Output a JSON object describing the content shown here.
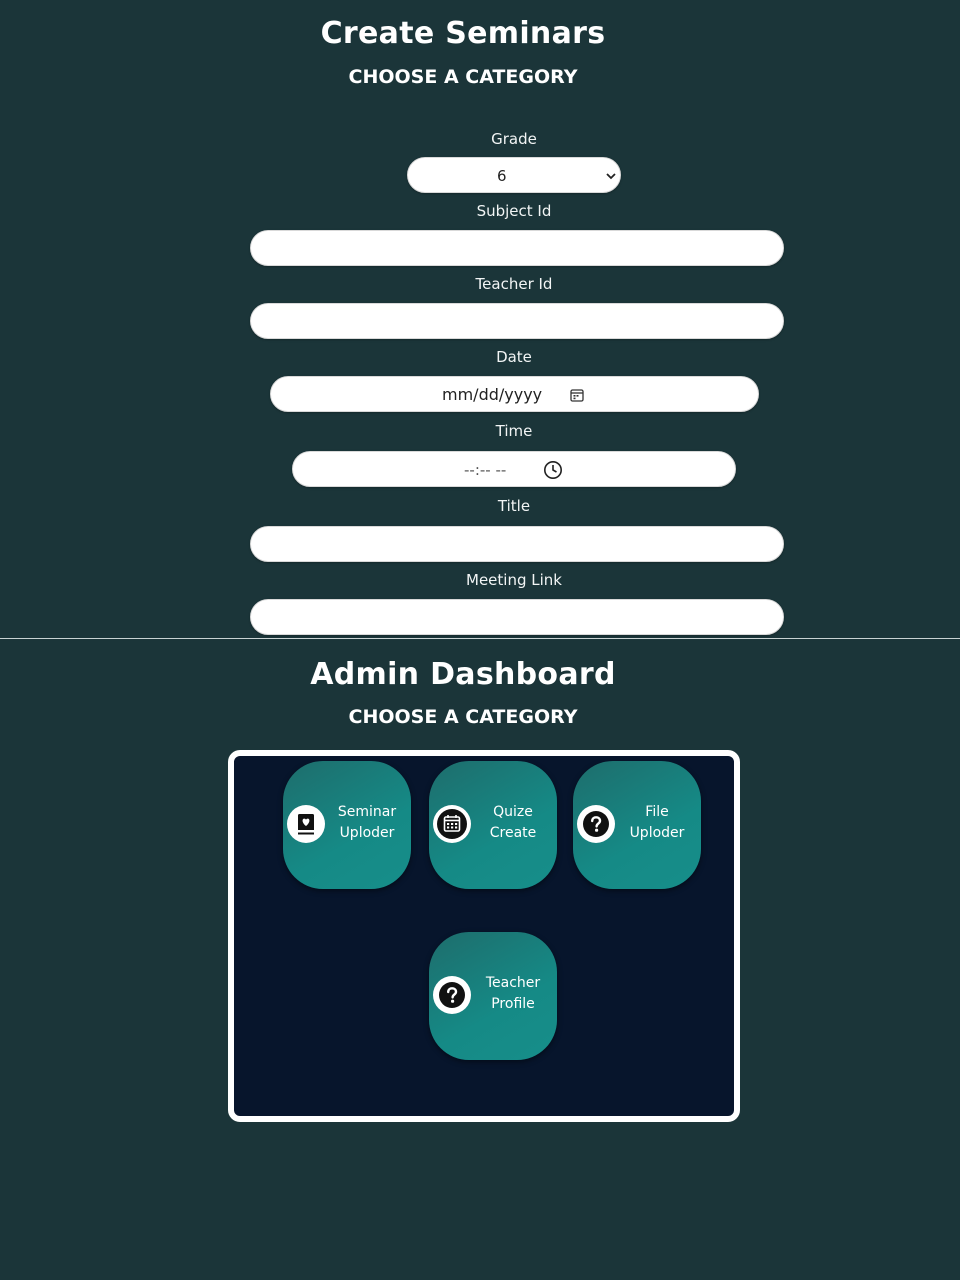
{
  "seminar_form": {
    "title": "Create Seminars",
    "subtitle": "CHOOSE A CATEGORY",
    "grade": {
      "label": "Grade",
      "value": "6"
    },
    "subject_id": {
      "label": "Subject Id",
      "value": ""
    },
    "teacher_id": {
      "label": "Teacher Id",
      "value": ""
    },
    "date": {
      "label": "Date",
      "placeholder": "mm/dd/yyyy",
      "icon": "calendar-icon"
    },
    "time": {
      "label": "Time",
      "placeholder": "--:-- --",
      "icon": "clock-icon"
    },
    "seminar_title": {
      "label": "Title",
      "value": ""
    },
    "meeting_link": {
      "label": "Meeting Link",
      "value": ""
    }
  },
  "dashboard": {
    "title": "Admin Dashboard",
    "subtitle": "CHOOSE A CATEGORY",
    "tiles": [
      {
        "line1": "Seminar",
        "line2": "Uploder",
        "icon": "book-heart-icon"
      },
      {
        "line1": "Quize",
        "line2": "Create",
        "icon": "calendar-icon"
      },
      {
        "line1": "File",
        "line2": "Uploder",
        "icon": "help-circle-icon"
      },
      {
        "line1": "Teacher",
        "line2": "Profile",
        "icon": "help-circle-icon"
      }
    ]
  },
  "colors": {
    "page_background": "#1b3539",
    "dashboard_background": "#07152c",
    "tile_teal": "#158a86",
    "field_white": "#ffffff"
  }
}
